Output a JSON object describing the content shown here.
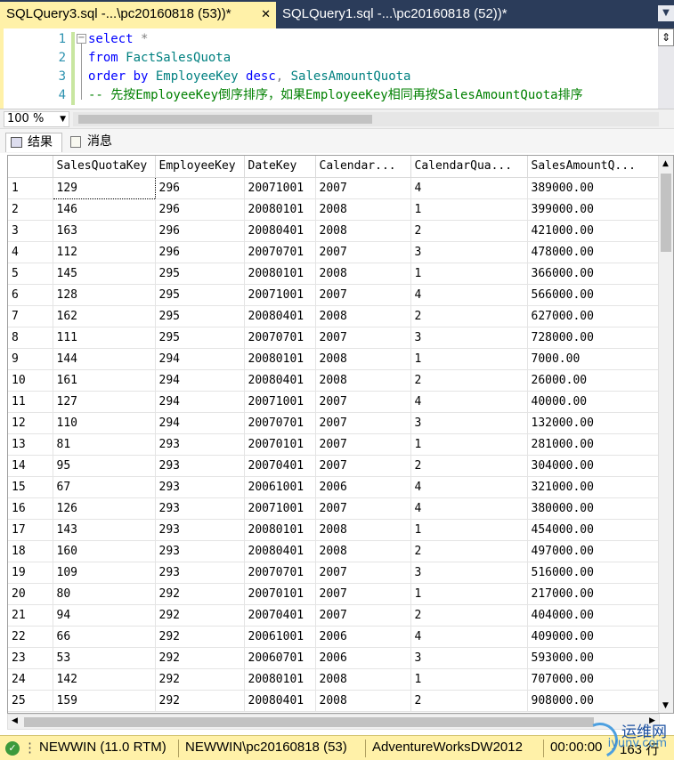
{
  "tabs": [
    {
      "label": "SQLQuery3.sql -...\\pc20160818 (53))*",
      "close": "✕"
    },
    {
      "label": "SQLQuery1.sql -...\\pc20160818 (52))*"
    }
  ],
  "editor": {
    "line_numbers": [
      "1",
      "2",
      "3",
      "4"
    ],
    "lines": [
      [
        {
          "t": "select",
          "c": "kw"
        },
        {
          "t": " ",
          "c": ""
        },
        {
          "t": "*",
          "c": "op"
        }
      ],
      [
        {
          "t": "from",
          "c": "kw"
        },
        {
          "t": " ",
          "c": ""
        },
        {
          "t": "FactSalesQuota",
          "c": "id"
        }
      ],
      [
        {
          "t": "order by",
          "c": "kw"
        },
        {
          "t": " ",
          "c": ""
        },
        {
          "t": "EmployeeKey",
          "c": "id"
        },
        {
          "t": " ",
          "c": ""
        },
        {
          "t": "desc",
          "c": "kw"
        },
        {
          "t": ",",
          "c": "op"
        },
        {
          "t": " ",
          "c": ""
        },
        {
          "t": "SalesAmountQuota",
          "c": "id"
        }
      ],
      [
        {
          "t": "-- 先按EmployeeKey倒序排序，如果EmployeeKey相同再按SalesAmountQuota排序",
          "c": "cmt"
        }
      ]
    ]
  },
  "zoom": {
    "value": "100 %"
  },
  "result_tabs": [
    {
      "label": "结果"
    },
    {
      "label": "消息"
    }
  ],
  "grid": {
    "columns": [
      "",
      "SalesQuotaKey",
      "EmployeeKey",
      "DateKey",
      "Calendar...",
      "CalendarQua...",
      "SalesAmountQ..."
    ],
    "rows": [
      [
        "1",
        "129",
        "296",
        "20071001",
        "2007",
        "4",
        "389000.00"
      ],
      [
        "2",
        "146",
        "296",
        "20080101",
        "2008",
        "1",
        "399000.00"
      ],
      [
        "3",
        "163",
        "296",
        "20080401",
        "2008",
        "2",
        "421000.00"
      ],
      [
        "4",
        "112",
        "296",
        "20070701",
        "2007",
        "3",
        "478000.00"
      ],
      [
        "5",
        "145",
        "295",
        "20080101",
        "2008",
        "1",
        "366000.00"
      ],
      [
        "6",
        "128",
        "295",
        "20071001",
        "2007",
        "4",
        "566000.00"
      ],
      [
        "7",
        "162",
        "295",
        "20080401",
        "2008",
        "2",
        "627000.00"
      ],
      [
        "8",
        "111",
        "295",
        "20070701",
        "2007",
        "3",
        "728000.00"
      ],
      [
        "9",
        "144",
        "294",
        "20080101",
        "2008",
        "1",
        "7000.00"
      ],
      [
        "10",
        "161",
        "294",
        "20080401",
        "2008",
        "2",
        "26000.00"
      ],
      [
        "11",
        "127",
        "294",
        "20071001",
        "2007",
        "4",
        "40000.00"
      ],
      [
        "12",
        "110",
        "294",
        "20070701",
        "2007",
        "3",
        "132000.00"
      ],
      [
        "13",
        "81",
        "293",
        "20070101",
        "2007",
        "1",
        "281000.00"
      ],
      [
        "14",
        "95",
        "293",
        "20070401",
        "2007",
        "2",
        "304000.00"
      ],
      [
        "15",
        "67",
        "293",
        "20061001",
        "2006",
        "4",
        "321000.00"
      ],
      [
        "16",
        "126",
        "293",
        "20071001",
        "2007",
        "4",
        "380000.00"
      ],
      [
        "17",
        "143",
        "293",
        "20080101",
        "2008",
        "1",
        "454000.00"
      ],
      [
        "18",
        "160",
        "293",
        "20080401",
        "2008",
        "2",
        "497000.00"
      ],
      [
        "19",
        "109",
        "293",
        "20070701",
        "2007",
        "3",
        "516000.00"
      ],
      [
        "20",
        "80",
        "292",
        "20070101",
        "2007",
        "1",
        "217000.00"
      ],
      [
        "21",
        "94",
        "292",
        "20070401",
        "2007",
        "2",
        "404000.00"
      ],
      [
        "22",
        "66",
        "292",
        "20061001",
        "2006",
        "4",
        "409000.00"
      ],
      [
        "23",
        "53",
        "292",
        "20060701",
        "2006",
        "3",
        "593000.00"
      ],
      [
        "24",
        "142",
        "292",
        "20080101",
        "2008",
        "1",
        "707000.00"
      ],
      [
        "25",
        "159",
        "292",
        "20080401",
        "2008",
        "2",
        "908000.00"
      ]
    ]
  },
  "statusbar": {
    "server": "NEWWIN (11.0 RTM)",
    "user": "NEWWIN\\pc20160818 (53)",
    "database": "AdventureWorksDW2012",
    "time": "00:00:00",
    "rows": "163 行"
  },
  "watermark": {
    "text": "运维网",
    "sub": "iyunv.com"
  },
  "colors": {
    "tab_bg": "#2b3c5a",
    "active_tab": "#fff1a8",
    "keyword": "#0000ff",
    "identifier": "#008080",
    "comment": "#008000",
    "line_number": "#2b91af",
    "status_ok": "#3c9a3c"
  }
}
